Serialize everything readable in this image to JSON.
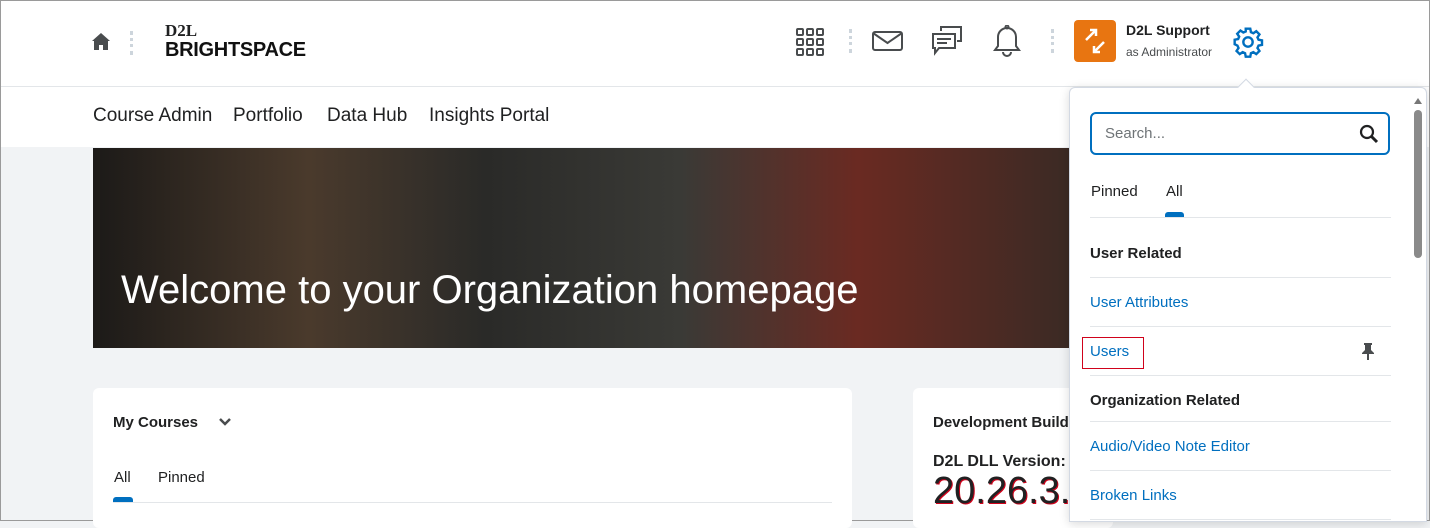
{
  "header": {
    "logo_top": "D2L",
    "logo_bottom": "BRIGHTSPACE",
    "user_name": "D2L Support",
    "user_role": "as Administrator"
  },
  "nav": {
    "items": [
      "Course Admin",
      "Portfolio",
      "Data Hub",
      "Insights Portal"
    ]
  },
  "banner": {
    "title": "Welcome to your Organization homepage"
  },
  "my_courses": {
    "title": "My Courses",
    "tabs": [
      "All",
      "Pinned"
    ]
  },
  "dev_build": {
    "title": "Development Build",
    "version_label": "D2L DLL Version:",
    "version": "20.26.3."
  },
  "admin_menu": {
    "search_placeholder": "Search...",
    "tabs": [
      "Pinned",
      "All"
    ],
    "items": [
      {
        "type": "header",
        "label": "User Related"
      },
      {
        "type": "link",
        "label": "User Attributes"
      },
      {
        "type": "link",
        "label": "Users"
      },
      {
        "type": "header",
        "label": "Organization Related"
      },
      {
        "type": "link",
        "label": "Audio/Video Note Editor"
      },
      {
        "type": "link",
        "label": "Broken Links"
      }
    ]
  },
  "colors": {
    "accent": "#006fbf",
    "orange": "#e87511",
    "highlight": "#d0021b"
  }
}
